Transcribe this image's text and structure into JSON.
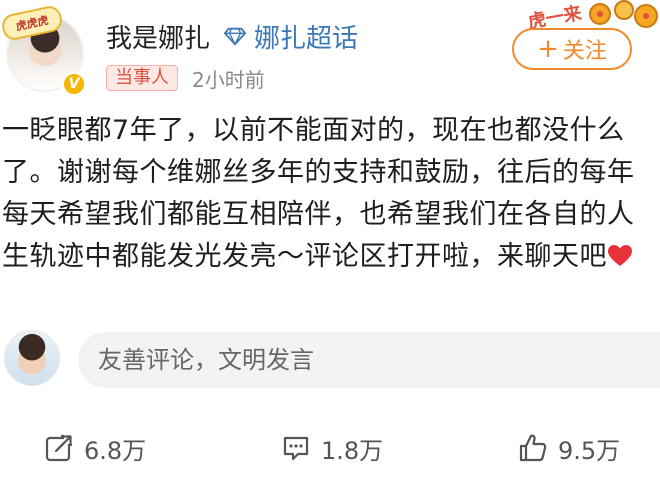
{
  "header": {
    "username": "我是娜扎",
    "topic_link": "娜扎超话",
    "role_tag": "当事人",
    "timestamp": "2小时前",
    "follow_label": "关注",
    "follow_plus": "+",
    "avatar_frame_text": "虎虎虎",
    "deco_text": "虎一来"
  },
  "post": {
    "text": "一眨眼都7年了，以前不能面对的，现在也都没什么了。谢谢每个维娜丝多年的支持和鼓励，往后的每年每天希望我们都能互相陪伴，也希望我们在各自的人生轨迹中都能发光发亮～评论区打开啦，来聊天吧"
  },
  "comment_box": {
    "placeholder": "友善评论，文明发言"
  },
  "actions": {
    "repost_count": "6.8万",
    "comment_count": "1.8万",
    "like_count": "9.5万"
  },
  "colors": {
    "accent_orange": "#f28a2c",
    "topic_blue": "#3b78b5",
    "tag_red": "#e0523f",
    "heart_red": "#e8323a"
  }
}
